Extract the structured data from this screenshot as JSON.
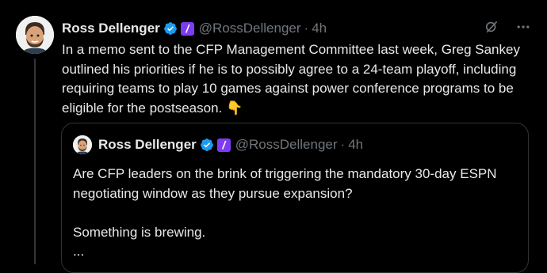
{
  "tweet": {
    "author_name": "Ross Dellenger",
    "handle": "@RossDellenger",
    "separator": "·",
    "time": "4h",
    "body": "In a memo sent to the CFP Management Committee last week, Greg Sankey outlined his priorities if he is to possibly agree to a 24-team playoff, including requiring teams to play 10 games against power conference programs to be eligible for the postseason.",
    "emoji": "👇",
    "affiliate_badge": "/",
    "icons": {
      "verified": "verified-badge-icon",
      "grok": "grok-icon",
      "more": "more-icon"
    }
  },
  "quoted_tweet": {
    "author_name": "Ross Dellenger",
    "handle": "@RossDellenger",
    "separator": "·",
    "time": "4h",
    "affiliate_badge": "/",
    "line1": "Are CFP leaders on the brink of triggering the mandatory 30-day ESPN negotiating window as they pursue expansion?",
    "line2": "Something is brewing.",
    "line3": "..."
  },
  "colors": {
    "background": "#000000",
    "text": "#e7e9ea",
    "muted": "#71767b",
    "verified": "#1d9bf0",
    "affiliate": "#7e3cf0",
    "border": "#2f3336"
  }
}
